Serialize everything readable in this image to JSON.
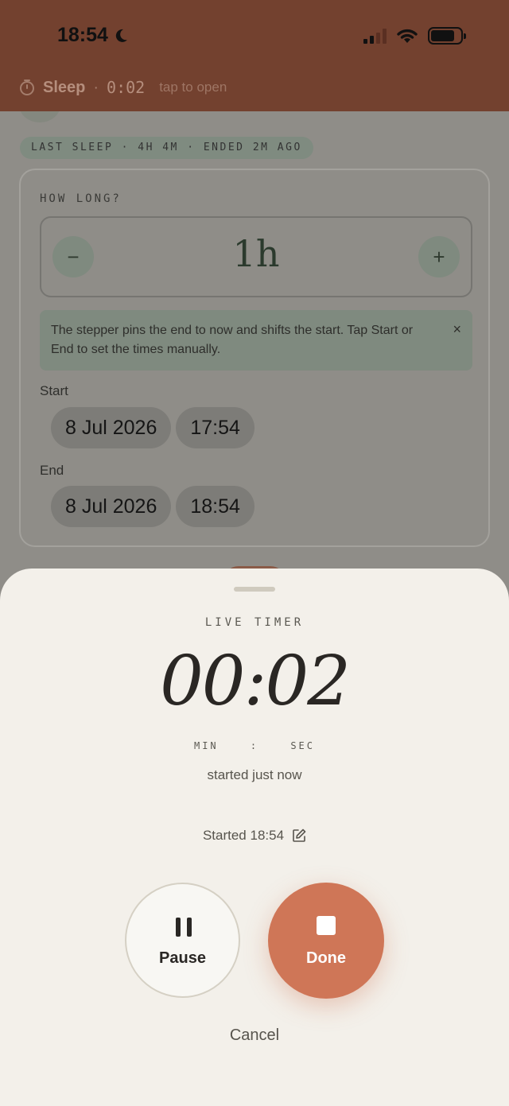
{
  "status_bar": {
    "time": "18:54",
    "icons": [
      "moon-icon",
      "cellular-signal-icon",
      "wifi-icon",
      "battery-icon"
    ],
    "signal_bars_active": 2,
    "battery_level": 0.8
  },
  "live_activity": {
    "icon": "timer-icon",
    "title": "Sleep",
    "separator": "·",
    "timer": "0:02",
    "hint": "tap to open"
  },
  "background_form": {
    "last_sleep_chip": "LAST SLEEP · 4H 4M · ENDED 2M AGO",
    "how_long_label": "HOW LONG?",
    "stepper": {
      "minus": "−",
      "value": "1h",
      "plus": "+"
    },
    "hint": {
      "text": "The stepper pins the end to now and shifts the start. Tap Start or End to set the times manually.",
      "close": "×"
    },
    "start": {
      "label": "Start",
      "date": "8 Jul 2026",
      "time": "17:54"
    },
    "end": {
      "label": "End",
      "date": "8 Jul 2026",
      "time": "18:54"
    }
  },
  "sheet": {
    "section_label": "LIVE TIMER",
    "timer": "00:02",
    "units": "MIN : SEC",
    "started_relative": "started just now",
    "started_at": "Started 18:54",
    "pause_label": "Pause",
    "done_label": "Done",
    "cancel_label": "Cancel"
  },
  "colors": {
    "accent": "#cf7657",
    "status_bar_bg": "#73412f",
    "sheet_bg": "#f3f0ea"
  }
}
